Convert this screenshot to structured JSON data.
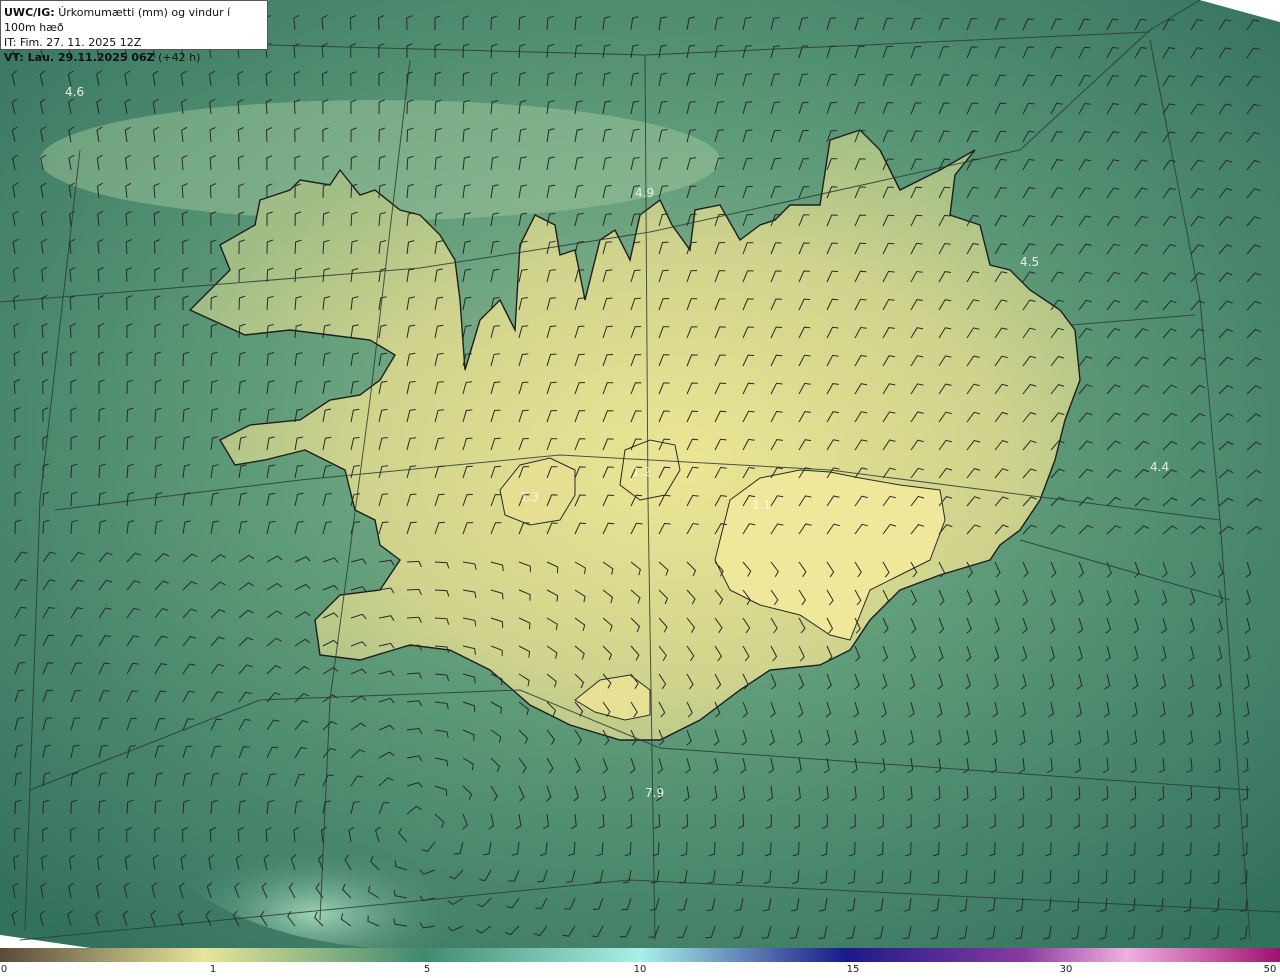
{
  "header": {
    "model": "UWC/IG:",
    "title": "Úrkomumætti (mm) og vindur í 100m hæð",
    "it_line": "IT: Fim. 27. 11. 2025 12Z",
    "vt_prefix": "VT: Lau. 29.11.2025 06Z",
    "vt_suffix": "(+42 h)"
  },
  "map_labels": [
    {
      "name": "label-4-6",
      "text": "4.6"
    },
    {
      "name": "label-4-9",
      "text": "4.9"
    },
    {
      "name": "label-4-5",
      "text": "4.5"
    },
    {
      "name": "label-4-4",
      "text": "4.4"
    },
    {
      "name": "label-7-9",
      "text": "7.9"
    },
    {
      "name": "label-1-2",
      "text": "1.2"
    },
    {
      "name": "label-1-1",
      "text": "1.1"
    },
    {
      "name": "label-1-3",
      "text": "1.3"
    }
  ],
  "colorbar": {
    "ticks": [
      "0",
      "1",
      "5",
      "10",
      "15",
      "30",
      "50"
    ],
    "stops": [
      "#5a4a3a",
      "#d8c79a",
      "#e6e59a",
      "#3f8a6e",
      "#a9f0e8",
      "#1a1a8a",
      "#8a3aa0",
      "#f0b0e0",
      "#a01070"
    ]
  },
  "colors": {
    "sea": "#3f7f6a",
    "land_high": "#e2e08e",
    "land_mid": "#b7c98a",
    "coast": "#1e1e1e"
  }
}
